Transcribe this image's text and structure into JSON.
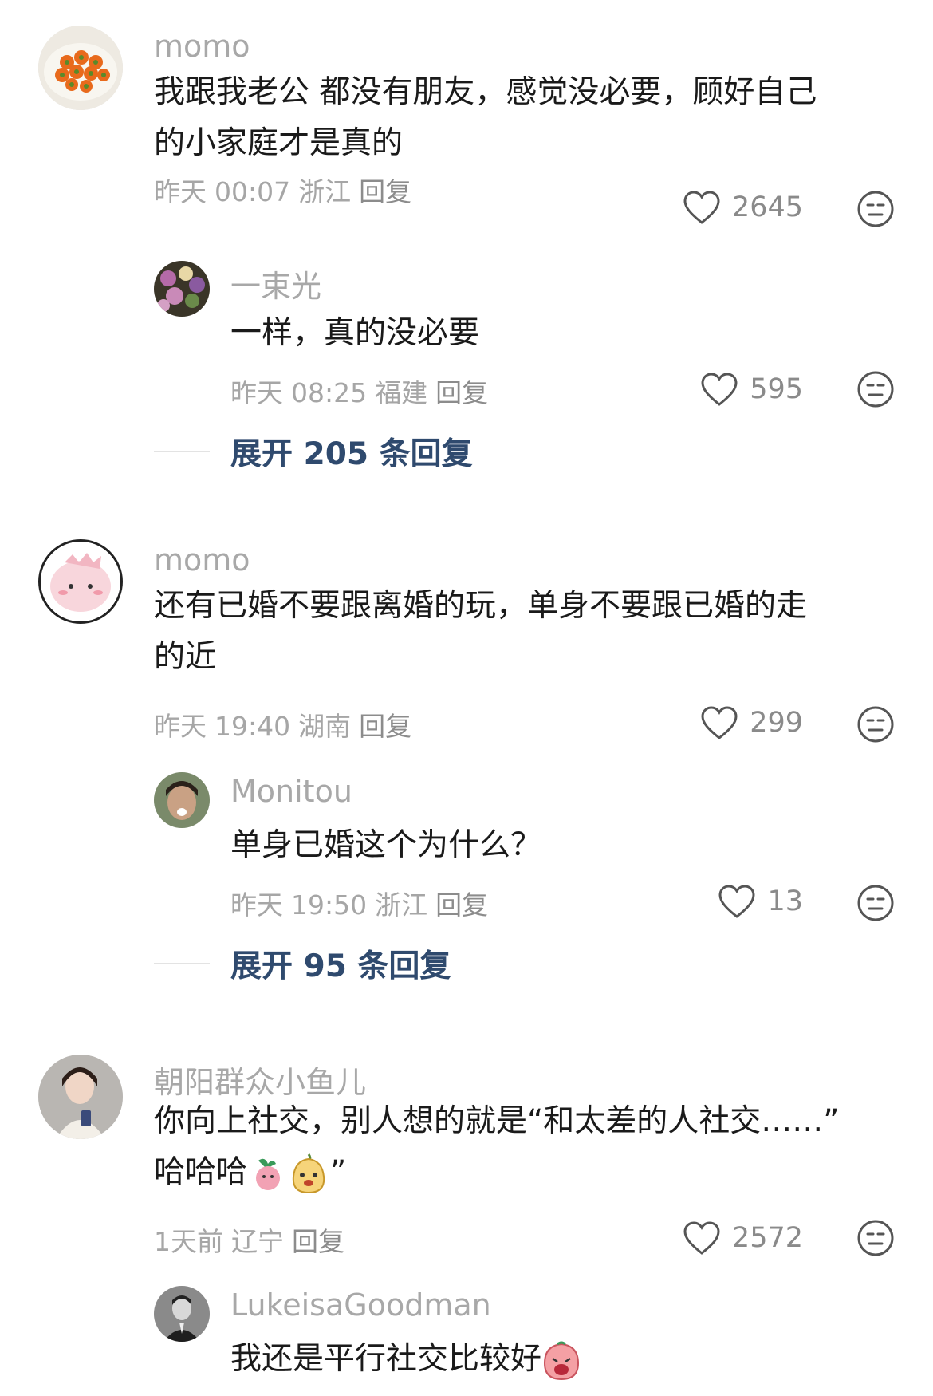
{
  "comments": [
    {
      "user": "momo",
      "text_lines": [
        "我跟我老公 都没有朋友，感觉没必要，顾好自己",
        "的小家庭才是真的"
      ],
      "date": "昨天",
      "time": "00:07",
      "location": "浙江",
      "reply_label": "回复",
      "likes": "2645",
      "replies": [
        {
          "user": "一束光",
          "text": "一样，真的没必要",
          "date": "昨天",
          "time": "08:25",
          "location": "福建",
          "reply_label": "回复",
          "likes": "595"
        }
      ],
      "expand_label": "展开 205 条回复"
    },
    {
      "user": "momo",
      "text_lines": [
        "还有已婚不要跟离婚的玩，单身不要跟已婚的走",
        "的近"
      ],
      "date": "昨天",
      "time": "19:40",
      "location": "湖南",
      "reply_label": "回复",
      "likes": "299",
      "replies": [
        {
          "user": "Monitou",
          "text": "单身已婚这个为什么？",
          "date": "昨天",
          "time": "19:50",
          "location": "浙江",
          "reply_label": "回复",
          "likes": "13"
        }
      ],
      "expand_label": "展开 95 条回复"
    },
    {
      "user": "朝阳群众小鱼儿",
      "text_lines": [
        "你向上社交，别人想的就是“和太差的人社交……”",
        "哈哈哈",
        "”"
      ],
      "date": "1天前",
      "location": "辽宁",
      "reply_label": "回复",
      "likes": "2572",
      "replies": [
        {
          "user": "LukeisaGoodman",
          "text": "我还是平行社交比较好"
        }
      ]
    }
  ],
  "icons": {
    "like": "heart-outline-icon",
    "reaction": "neutral-face-icon"
  },
  "colors": {
    "expand_link": "#2f4a6e",
    "username": "#a8a8a8",
    "meta": "#a6a6a6"
  }
}
